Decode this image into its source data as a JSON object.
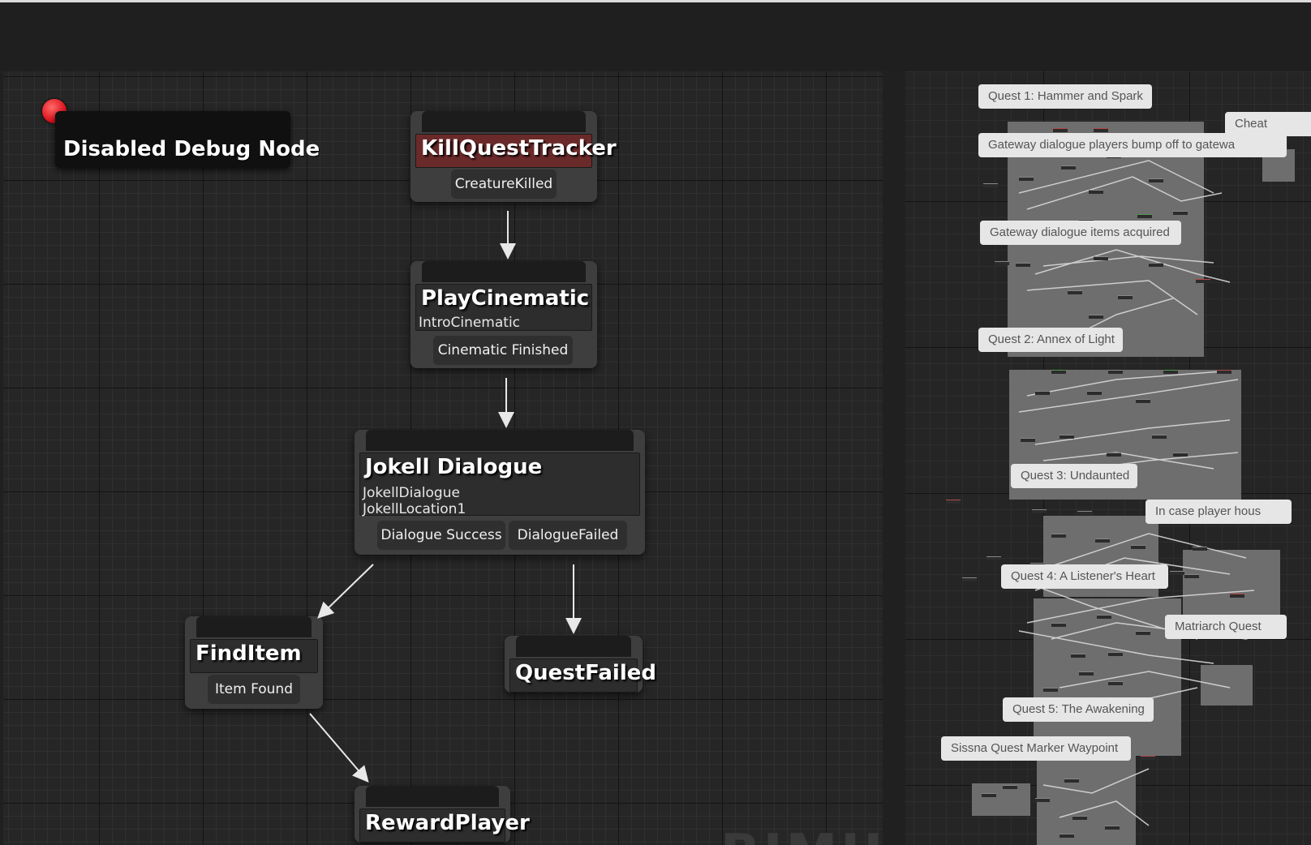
{
  "debug_node": {
    "label": "Disabled Debug Node"
  },
  "nodes": {
    "kill_quest_tracker": {
      "title": "KillQuestTracker",
      "pins": [
        "CreatureKilled"
      ]
    },
    "play_cinematic": {
      "title": "PlayCinematic",
      "details": [
        "IntroCinematic"
      ],
      "pins": [
        "Cinematic Finished"
      ]
    },
    "jokell_dialogue": {
      "title": "Jokell Dialogue",
      "details": [
        "JokellDialogue",
        "JokellLocation1"
      ],
      "pins": [
        "Dialogue Success",
        "DialogueFailed"
      ]
    },
    "find_item": {
      "title": "FindItem",
      "pins": [
        "Item Found"
      ]
    },
    "quest_failed": {
      "title": "QuestFailed"
    },
    "reward_player": {
      "title": "RewardPlayer"
    }
  },
  "watermark": "BIMU",
  "overview": {
    "comments": [
      "Quest 1: Hammer and Spark",
      "Cheat",
      "Gateway dialogue   players bump off to gatewa",
      "Gateway dialogue items acquired",
      "Quest 2: Annex of Light",
      "Quest 3: Undaunted",
      "In case player hous",
      "Quest 4: A Listener's Heart",
      "Matriarch Quest",
      "Quest 5: The Awakening",
      "Sissna Quest Marker Waypoint"
    ]
  },
  "colors": {
    "graph_bg": "#262626",
    "node_bg": "#3e3e3e",
    "active_node_title": "#6b2a2a",
    "debug_dot": "#e0151f",
    "comment_label": "#e6e6e6"
  }
}
